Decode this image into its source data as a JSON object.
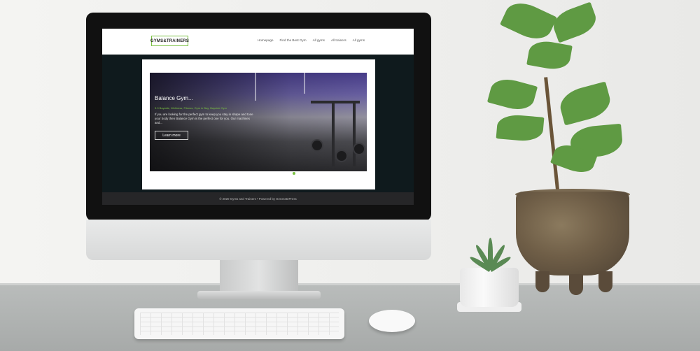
{
  "site": {
    "logo_text": "GYMS&TRAINERS",
    "nav": {
      "items": [
        "Homepage",
        "Find the Best Gym",
        "All gyms",
        "All trainers",
        "All gyms"
      ]
    },
    "slider": {
      "title": "Balance Gym...",
      "subtitle": "3.0 Bayside, Wellness, Fitness, Gym in Bay, Bayside Gym",
      "description": "If you are looking for the perfect gym to keep you stay in shape and tone your body then Balance Gym is the perfect one for you. Our machines and...",
      "button_label": "Learn more",
      "active_dot": 1
    },
    "footer": {
      "text": "© 2020 Gyms and Trainers • Powered by GeneratePress"
    }
  },
  "colors": {
    "accent": "#7ac143",
    "screen_bg": "#0f1a1d",
    "footer_bg": "#262628"
  }
}
